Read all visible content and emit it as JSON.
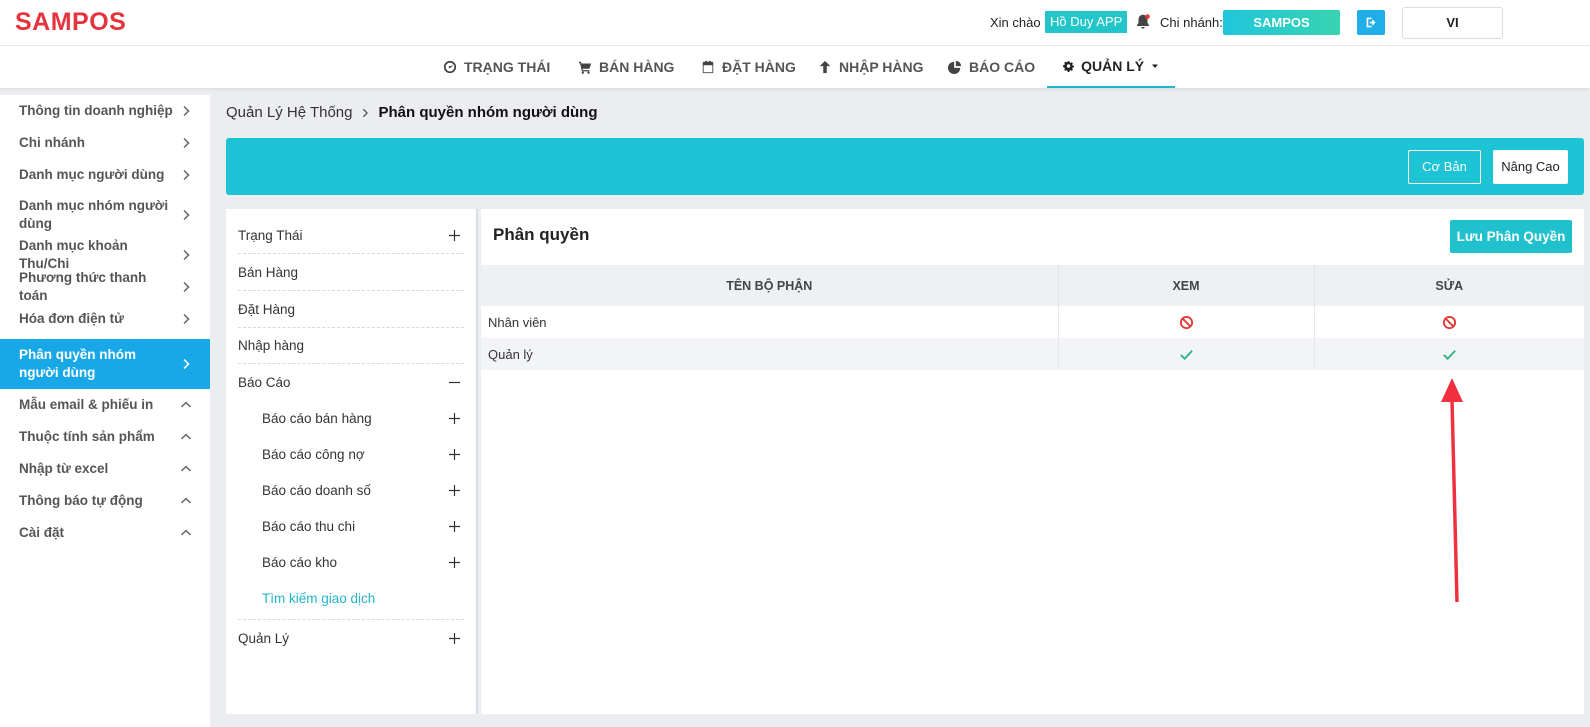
{
  "header": {
    "logo": "SAMPOS",
    "greeting": "Xin chào",
    "user_name": "Hồ Duy APP",
    "branch_label": "Chi nhánh:",
    "branch_name": "SAMPOS",
    "language": "VI"
  },
  "nav": {
    "items": [
      {
        "label": "TRẠNG THÁI",
        "icon": "dashboard-icon"
      },
      {
        "label": "BÁN HÀNG",
        "icon": "cart-icon"
      },
      {
        "label": "ĐẶT HÀNG",
        "icon": "calendar-icon"
      },
      {
        "label": "NHẬP HÀNG",
        "icon": "arrow-up-icon"
      },
      {
        "label": "BÁO CÁO",
        "icon": "pie-chart-icon"
      },
      {
        "label": "QUẢN LÝ",
        "icon": "gear-icon",
        "active": true
      }
    ]
  },
  "sidebar": {
    "items": [
      {
        "label": "Thông tin doanh nghiệp"
      },
      {
        "label": "Chi nhánh"
      },
      {
        "label": "Danh mục người dùng"
      },
      {
        "label": "Danh mục nhóm người dùng"
      },
      {
        "label": "Danh mục khoản Thu/Chi"
      },
      {
        "label": "Phương thức thanh toán"
      },
      {
        "label": "Hóa đơn điện tử"
      },
      {
        "label": "Phân quyền nhóm người dùng",
        "active": true
      },
      {
        "label": "Mẫu email & phiếu in"
      },
      {
        "label": "Thuộc tính sản phẩm"
      },
      {
        "label": "Nhập từ excel"
      },
      {
        "label": "Thông báo tự động"
      },
      {
        "label": "Cài đặt"
      }
    ]
  },
  "breadcrumb": {
    "parent": "Quản Lý Hệ Thống",
    "current": "Phân quyền nhóm người dùng"
  },
  "toolbar": {
    "basic": "Cơ Bản",
    "advanced": "Nâng Cao"
  },
  "modules": {
    "items": [
      {
        "label": "Trạng Thái",
        "sign": "plus"
      },
      {
        "label": "Bán Hàng"
      },
      {
        "label": "Đặt Hàng"
      },
      {
        "label": "Nhập hàng"
      },
      {
        "label": "Báo Cáo",
        "sign": "minus"
      },
      {
        "label": "Báo cáo bán hàng",
        "sign": "plus"
      },
      {
        "label": "Báo cáo công nợ",
        "sign": "plus"
      },
      {
        "label": "Báo cáo doanh số",
        "sign": "plus"
      },
      {
        "label": "Báo cáo thu chi",
        "sign": "plus"
      },
      {
        "label": "Báo cáo kho",
        "sign": "plus"
      },
      {
        "label": "Tìm kiếm giao dịch"
      },
      {
        "label": "Quản Lý",
        "sign": "plus"
      }
    ]
  },
  "permissions": {
    "title": "Phân quyền",
    "save_label": "Lưu Phân Quyền",
    "columns": [
      "TÊN BỘ PHẬN",
      "XEM",
      "SỬA"
    ],
    "rows": [
      {
        "name": "Nhân viên",
        "view": "denied",
        "edit": "denied"
      },
      {
        "name": "Quản lý",
        "view": "allowed",
        "edit": "allowed"
      }
    ]
  },
  "colors": {
    "brand": "#e5343d",
    "accent": "#1cc4d6",
    "active_sidebar": "#18a8e8",
    "allowed": "#2eb67d",
    "denied": "#e53935",
    "annotation_arrow": "#f0303f"
  }
}
